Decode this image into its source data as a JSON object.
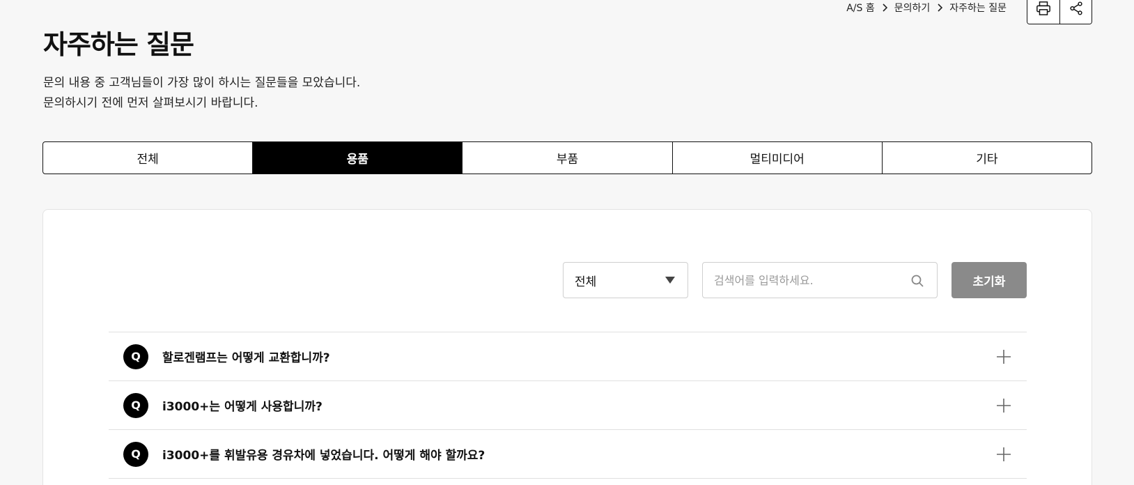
{
  "breadcrumb": {
    "items": [
      "A/S 홈",
      "문의하기",
      "자주하는 질문"
    ]
  },
  "utility": {
    "print_icon": "print-icon",
    "share_icon": "share-icon"
  },
  "page": {
    "title": "자주하는 질문",
    "description_line1": "문의 내용 중 고객님들이 가장 많이 하시는 질문들을 모았습니다.",
    "description_line2": "문의하시기 전에 먼저 살펴보시기 바랍니다."
  },
  "tabs": [
    {
      "label": "전체",
      "active": false
    },
    {
      "label": "용품",
      "active": true
    },
    {
      "label": "부품",
      "active": false
    },
    {
      "label": "멀티미디어",
      "active": false
    },
    {
      "label": "기타",
      "active": false
    }
  ],
  "filter": {
    "selected": "전체"
  },
  "search": {
    "placeholder": "검색어를 입력하세요.",
    "value": ""
  },
  "reset_label": "초기화",
  "faq": {
    "badge": "Q",
    "items": [
      {
        "question": "할로겐램프는 어떻게 교환합니까?"
      },
      {
        "question": "i3000+는 어떻게 사용합니까?"
      },
      {
        "question": "i3000+를 휘발유용 경유차에 넣었습니다. 어떻게 해야 할까요?"
      }
    ]
  },
  "colors": {
    "background": "#f7f7f7",
    "active_tab": "#000000",
    "reset_button": "#8a8a8a",
    "badge": "#000000"
  }
}
